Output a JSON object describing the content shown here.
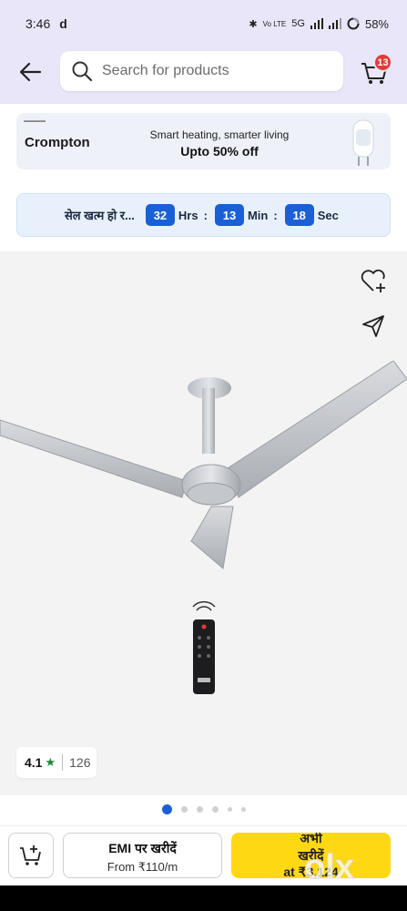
{
  "status_bar": {
    "time": "3:46",
    "carrier_icon": "d",
    "network": "5G",
    "battery": "58%"
  },
  "header": {
    "search_placeholder": "Search for products",
    "cart_count": "13"
  },
  "ad_banner": {
    "brand": "Crompton",
    "line1": "Smart heating, smarter living",
    "line2": "Upto 50% off"
  },
  "sale": {
    "text": "सेल खत्म हो र...",
    "hours": "32",
    "hours_label": "Hrs",
    "minutes": "13",
    "minutes_label": "Min",
    "seconds": "18",
    "seconds_label": "Sec",
    "separator": ":"
  },
  "product": {
    "rating": "4.1",
    "rating_count": "126",
    "image_count": 6,
    "active_image": 1
  },
  "bottom_bar": {
    "emi_title": "EMI पर खरीदें",
    "emi_sub": "From ₹110/m",
    "buy_line1": "अभी",
    "buy_line2": "खरीदें",
    "buy_line3": "at ₹3,124"
  },
  "watermark": "olx",
  "colors": {
    "header_bg": "#e8e6f8",
    "accent_blue": "#1a5fd6",
    "buy_yellow": "#ffd814",
    "badge_red": "#e53935",
    "rating_green": "#1b8a3a"
  }
}
